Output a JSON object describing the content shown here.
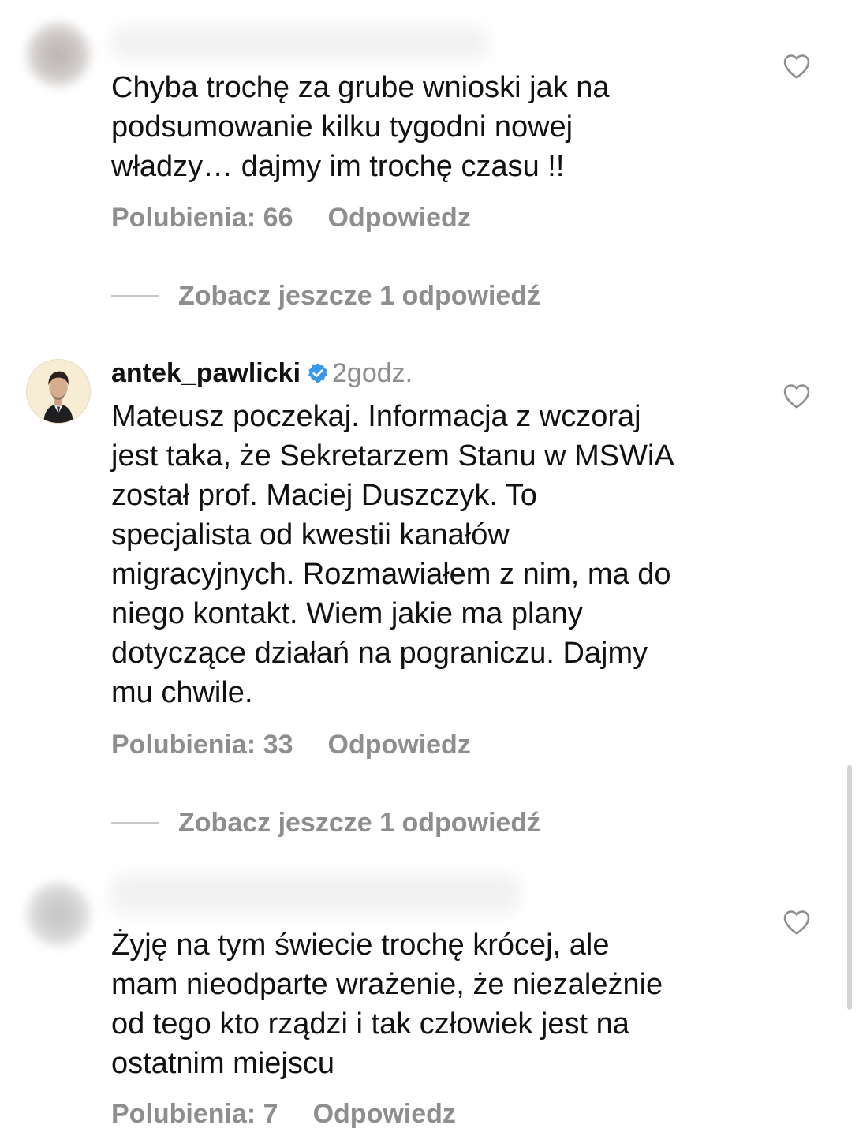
{
  "comments": [
    {
      "username": "",
      "verified": false,
      "time": "",
      "lines": [
        "Chyba trochę za grube wnioski jak na",
        "podsumowanie kilku tygodni nowej",
        "władzy… dajmy im trochę czasu !!"
      ],
      "likes_label": "Polubienia: 66",
      "reply_label": "Odpowiedz",
      "more_replies_label": "Zobacz jeszcze 1 odpowiedź",
      "like_icon": "heart-outline-icon"
    },
    {
      "username": "antek_pawlicki",
      "verified": true,
      "time": "2godz.",
      "lines": [
        "Mateusz poczekaj. Informacja z wczoraj",
        "jest taka, że Sekretarzem Stanu w MSWiA",
        "został prof. Maciej Duszczyk. To",
        "specjalista od kwestii kanałów",
        "migracyjnych. Rozmawiałem z nim, ma do",
        "niego kontakt. Wiem jakie ma plany",
        "dotyczące działań na pograniczu. Dajmy",
        "mu chwile."
      ],
      "likes_label": "Polubienia: 33",
      "reply_label": "Odpowiedz",
      "more_replies_label": "Zobacz jeszcze 1 odpowiedź",
      "like_icon": "heart-outline-icon"
    },
    {
      "username": "",
      "verified": false,
      "time": "",
      "lines": [
        "Żyję na tym świecie trochę krócej, ale",
        "mam nieodparte wrażenie, że niezależnie",
        "od tego kto rządzi i tak człowiek jest na",
        "ostatnim miejscu"
      ],
      "likes_label": "Polubienia: 7",
      "reply_label": "Odpowiedz",
      "like_icon": "heart-outline-icon"
    }
  ],
  "colors": {
    "text": "#111111",
    "muted": "#8e8e8e",
    "verified_badge": "#3897f0",
    "divider": "#c7c7c7"
  }
}
